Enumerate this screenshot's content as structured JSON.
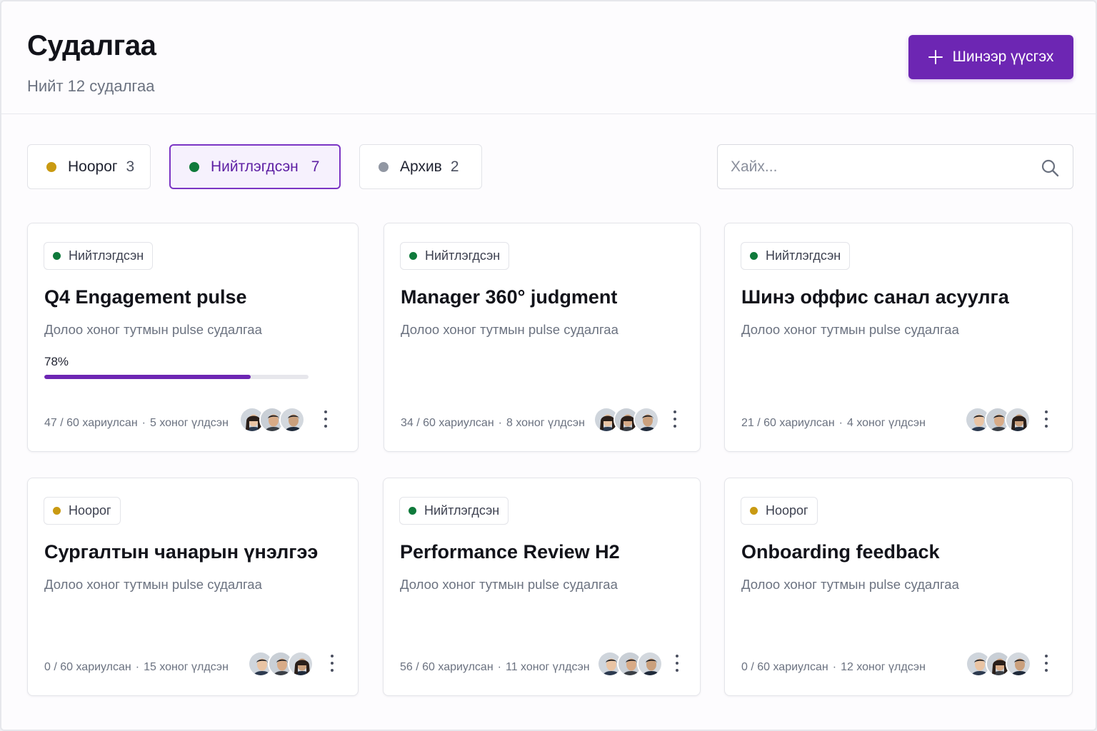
{
  "header": {
    "title": "Судалгаа",
    "subtitle": "Нийт 12 судалгаа",
    "create_button": {
      "label": "Шинээр үүсгэх",
      "icon": "plus-icon"
    }
  },
  "filters": [
    {
      "label": "Ноорог",
      "count": "3",
      "color": "#c99a12",
      "active": false
    },
    {
      "label": "Нийтлэгдсэн",
      "count": "7",
      "color": "#0f7a3b",
      "active": true
    },
    {
      "label": "Архив",
      "count": "2",
      "color": "#9197a3",
      "active": false
    }
  ],
  "search": {
    "placeholder": "Хайх...",
    "value": "",
    "icon": "search-icon"
  },
  "colors": {
    "accent": "#6d26b3",
    "published": "#0f7a3b",
    "draft": "#c99a12",
    "archived": "#9197a3"
  },
  "cards": [
    {
      "status": "Нийтлэгдсэн",
      "status_color": "#0f7a3b",
      "title": "Q4 Engagement pulse",
      "description": "Долоо хоног тутмын pulse судалгаа",
      "progress_label": "78%",
      "progress": 0.78,
      "responses": "47 / 60 хариулсан",
      "remaining": "5 хоног үлдсэн",
      "avatars": [
        "woman",
        "man",
        "man"
      ]
    },
    {
      "status": "Нийтлэгдсэн",
      "status_color": "#0f7a3b",
      "title": "Manager 360° judgment",
      "description": "Долоо хоног тутмын pulse судалгаа",
      "progress_label": null,
      "progress": null,
      "responses": "34 / 60 хариулсан",
      "remaining": "8 хоног үлдсэн",
      "avatars": [
        "woman",
        "woman",
        "man"
      ]
    },
    {
      "status": "Нийтлэгдсэн",
      "status_color": "#0f7a3b",
      "title": "Шинэ оффис санал асуулга",
      "description": "Долоо хоног тутмын pulse судалгаа",
      "progress_label": null,
      "progress": null,
      "responses": "21 / 60 хариулсан",
      "remaining": "4 хоног үлдсэн",
      "avatars": [
        "man",
        "man",
        "woman"
      ]
    },
    {
      "status": "Ноорог",
      "status_color": "#c99a12",
      "title": "Сургалтын чанарын үнэлгээ",
      "description": "Долоо хоног тутмын pulse судалгаа",
      "progress_label": null,
      "progress": null,
      "responses": "0 / 60 хариулсан",
      "remaining": "15 хоног үлдсэн",
      "avatars": [
        "man",
        "man",
        "woman"
      ]
    },
    {
      "status": "Нийтлэгдсэн",
      "status_color": "#0f7a3b",
      "title": "Performance Review H2",
      "description": "Долоо хоног тутмын pulse судалгаа",
      "progress_label": null,
      "progress": null,
      "responses": "56 / 60 хариулсан",
      "remaining": "11 хоног үлдсэн",
      "avatars": [
        "man",
        "man",
        "man"
      ]
    },
    {
      "status": "Ноорог",
      "status_color": "#c99a12",
      "title": "Onboarding feedback",
      "description": "Долоо хоног тутмын pulse судалгаа",
      "progress_label": null,
      "progress": null,
      "responses": "0 / 60 хариулсан",
      "remaining": "12 хоног үлдсэн",
      "avatars": [
        "man",
        "woman",
        "man"
      ]
    }
  ]
}
